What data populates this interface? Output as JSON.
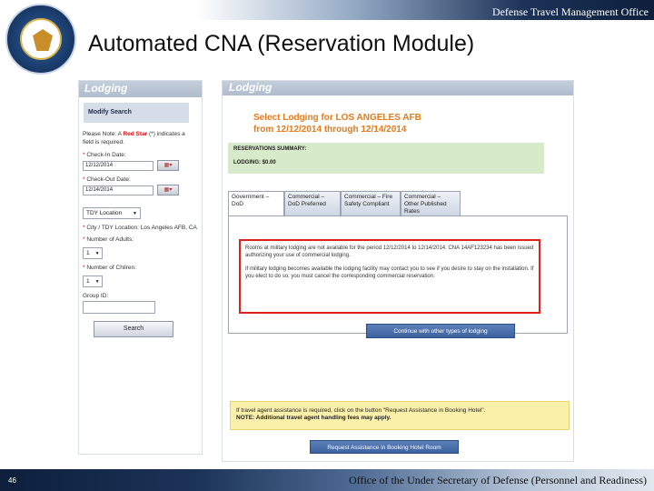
{
  "header": {
    "organization": "Defense Travel Management Office",
    "title": "Automated CNA (Reservation Module)"
  },
  "left_panel": {
    "tab_label": "Lodging",
    "modify_search": "Modify Search",
    "note_prefix": "Please Note: A",
    "note_red": "Red Star",
    "note_suffix": "(*) indicates a field is required.",
    "check_in_label": "Check-In Date:",
    "check_in_value": "12/12/2014",
    "check_out_label": "Check-Out Date:",
    "check_out_value": "12/14/2014",
    "location_type": "TDY Location",
    "city_label": "City / TDY Location: Los Angeles AFB, CA",
    "adults_label": "Number of Adults:",
    "adults_value": "1",
    "children_label": "Number of Chilren:",
    "children_value": "1",
    "group_id_label": "Group ID:",
    "search_button": "Search"
  },
  "right_panel": {
    "tab_label": "Lodging",
    "heading_line1": "Select Lodging for LOS ANGELES AFB",
    "heading_line2": "from 12/12/2014 through 12/14/2014",
    "summary_title": "RESERVATIONS SUMMARY:",
    "summary_lodging": "LODGING:   $0.00",
    "tabs": [
      {
        "label": "Government – DoD"
      },
      {
        "label": "Commercial – DoD Preferred"
      },
      {
        "label": "Commercial – Fire Safety Compliant"
      },
      {
        "label": "Commercial – Other Published Rates"
      }
    ],
    "alert_p1": "Rooms at military lodging are not available for the period 12/12/2014 to 12/14/2014. CNA 14AF123234 has been issued authorizing your use of commercial lodging.",
    "alert_p2": "If military lodging becomes available the lodging facility may contact you to see if you desire to stay on the installation. If you elect to do so, you must cancel the corresponding commercial reservation.",
    "continue_button": "Continue with other types of lodging",
    "assist_line1": "If travel agent assistance is required, click on the button \"Request Assistance in Booking Hotel\".",
    "assist_line2": "NOTE: Additional travel agent handling fees may apply.",
    "request_button": "Request Assistance in Booking Hotel Room"
  },
  "footer": {
    "page_number": "46",
    "text": "Office of the Under Secretary of Defense (Personnel and Readiness)"
  },
  "icons": [
    "seal-logo",
    "calendar-icon",
    "dropdown-arrow-icon"
  ]
}
